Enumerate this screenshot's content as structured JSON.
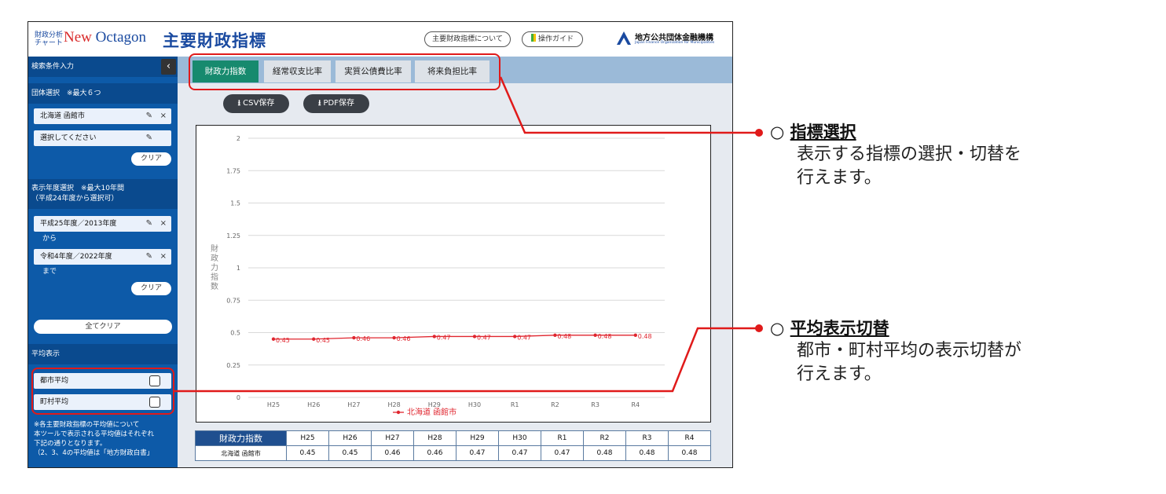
{
  "header": {
    "logo_small": "財政分析チャート",
    "logo_brand_new": "New",
    "logo_brand_octagon": "Octagon",
    "app_title": "主要財政指標",
    "about_button": "主要財政指標について",
    "guide_button": "操作ガイド",
    "org_name": "地方公共団体金融機構",
    "org_name_en": "Japan Finance Organization for Municipalities"
  },
  "sidebar": {
    "search_header": "検索条件入力",
    "collapse_icon": "chevron-left-icon",
    "entity_header": "団体選択　※最大６つ",
    "entity1": "北海道 函館市",
    "entity2": "選択してください",
    "clear_label": "クリア",
    "year_header_line1": "表示年度選択　※最大10年間",
    "year_header_line2": "（平成24年度から選択可）",
    "year_from": "平成25年度／2013年度",
    "year_from_suffix": "から",
    "year_to": "令和4年度／2022年度",
    "year_to_suffix": "まで",
    "clear_all_label": "全てクリア",
    "avg_header": "平均表示",
    "city_avg": "都市平均",
    "town_avg": "町村平均",
    "note_line1": "※各主要財政指標の平均値について",
    "note_line2": "本ツールで表示される平均値はそれぞれ",
    "note_line3": "下記の通りとなります。",
    "note_line4": "（2、3、4の平均値は「地方財政白書」"
  },
  "tabs": [
    "財政力指数",
    "経常収支比率",
    "実質公債費比率",
    "将来負担比率"
  ],
  "downloads": {
    "csv": "CSV保存",
    "pdf": "PDF保存"
  },
  "chart_data": {
    "type": "line",
    "categories": [
      "H25",
      "H26",
      "H27",
      "H28",
      "H29",
      "H30",
      "R1",
      "R2",
      "R3",
      "R4"
    ],
    "series": [
      {
        "name": "北海道 函館市",
        "values": [
          0.45,
          0.45,
          0.46,
          0.46,
          0.47,
          0.47,
          0.47,
          0.48,
          0.48,
          0.48
        ]
      }
    ],
    "ylabel": "財政力指数",
    "ylim": [
      0,
      2
    ],
    "yticks": [
      0,
      0.25,
      0.5,
      0.75,
      1,
      1.25,
      1.5,
      1.75,
      2
    ],
    "grid": true,
    "legend": "bottom",
    "series_color": "#e0262f"
  },
  "table": {
    "header_label": "財政力指数",
    "years": [
      "H25",
      "H26",
      "H27",
      "H28",
      "H29",
      "H30",
      "R1",
      "R2",
      "R3",
      "R4"
    ],
    "row_label": "北海道 函館市",
    "values": [
      "0.45",
      "0.45",
      "0.46",
      "0.46",
      "0.47",
      "0.47",
      "0.47",
      "0.48",
      "0.48",
      "0.48"
    ]
  },
  "callouts": {
    "c1_mark": "○",
    "c1_title": "指標選択",
    "c1_line1": "表示する指標の選択・切替を",
    "c1_line2": "行えます。",
    "c2_mark": "○",
    "c2_title": "平均表示切替",
    "c2_line1": "都市・町村平均の表示切替が",
    "c2_line2": "行えます。",
    "highlight_color": "#e01a1a"
  }
}
